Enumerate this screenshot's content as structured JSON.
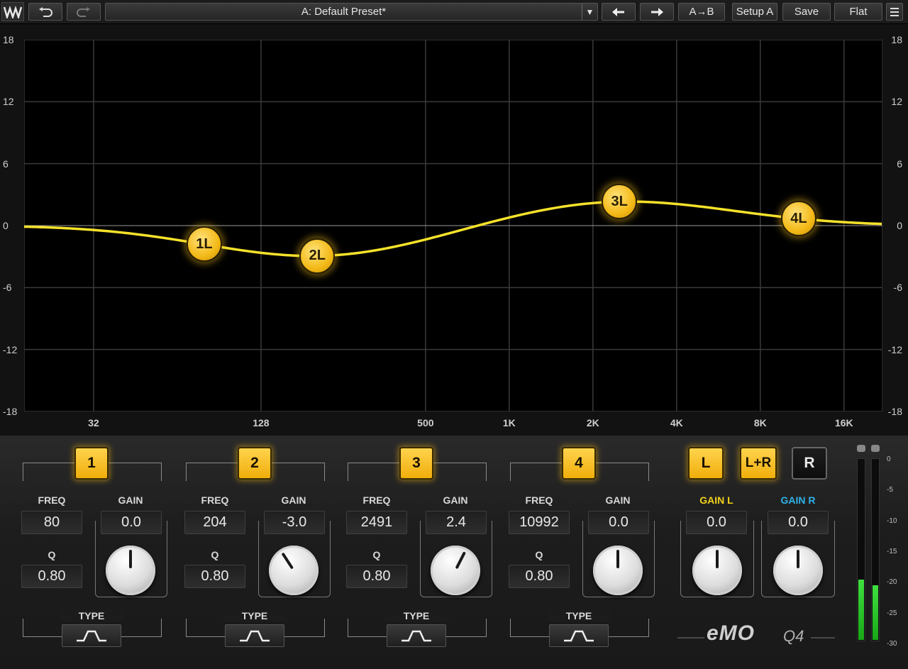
{
  "toolbar": {
    "preset": "A: Default Preset*",
    "ab_label": "A→B",
    "setup_label": "Setup A",
    "save_label": "Save",
    "flat_label": "Flat"
  },
  "graph": {
    "db_ticks": [
      "18",
      "12",
      "6",
      "0",
      "-6",
      "-12",
      "-18"
    ],
    "freq_ticks": [
      "32",
      "128",
      "500",
      "1K",
      "2K",
      "4K",
      "8K",
      "16K"
    ],
    "curve_color": "#f5e22a",
    "nodes": [
      {
        "label": "1L",
        "freq": 80,
        "gain": 0.0
      },
      {
        "label": "2L",
        "freq": 204,
        "gain": -3.0
      },
      {
        "label": "3L",
        "freq": 2491,
        "gain": 2.4
      },
      {
        "label": "4L",
        "freq": 10992,
        "gain": 0.0
      }
    ]
  },
  "bands": [
    {
      "number": "1",
      "freq_label": "FREQ",
      "freq": "80",
      "q_label": "Q",
      "q": "0.80",
      "gain_label": "GAIN",
      "gain": "0.0",
      "type_label": "TYPE",
      "knob_deg": 0
    },
    {
      "number": "2",
      "freq_label": "FREQ",
      "freq": "204",
      "q_label": "Q",
      "q": "0.80",
      "gain_label": "GAIN",
      "gain": "-3.0",
      "type_label": "TYPE",
      "knob_deg": -33
    },
    {
      "number": "3",
      "freq_label": "FREQ",
      "freq": "2491",
      "q_label": "Q",
      "q": "0.80",
      "gain_label": "GAIN",
      "gain": "2.4",
      "type_label": "TYPE",
      "knob_deg": 27
    },
    {
      "number": "4",
      "freq_label": "FREQ",
      "freq": "10992",
      "q_label": "Q",
      "q": "0.80",
      "gain_label": "GAIN",
      "gain": "0.0",
      "type_label": "TYPE",
      "knob_deg": 0
    }
  ],
  "channels": {
    "l_label": "L",
    "lr_label": "L+R",
    "r_label": "R",
    "gain_l_label": "GAIN L",
    "gain_l": "0.0",
    "gain_r_label": "GAIN R",
    "gain_r": "0.0",
    "gain_l_color": "#f2d21c",
    "gain_r_color": "#2fb2e8"
  },
  "meter": {
    "scale": [
      "0",
      "-5",
      "-10",
      "-15",
      "-20",
      "-25",
      "-30"
    ],
    "left_level_db": -20,
    "right_level_db": -21
  },
  "brand": {
    "name": "eMO",
    "model": "Q4"
  }
}
